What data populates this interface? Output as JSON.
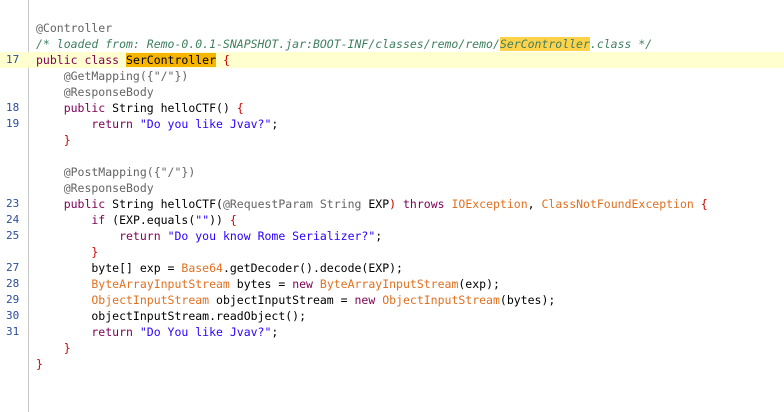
{
  "editor": {
    "lines": [
      {
        "num": "",
        "highlight": false,
        "tokens": [
          {
            "t": "@Controller",
            "c": "ann"
          }
        ]
      },
      {
        "num": "",
        "highlight": false,
        "tokens": [
          {
            "t": "/* loaded from: Remo-0.0.1-SNAPSHOT.jar:BOOT-INF/classes/remo/remo/",
            "c": "cmt"
          },
          {
            "t": "SerController",
            "c": "cmt occ"
          },
          {
            "t": ".class */",
            "c": "cmt"
          }
        ]
      },
      {
        "num": "17",
        "highlight": true,
        "tokens": [
          {
            "t": "public class ",
            "c": "kw"
          },
          {
            "t": "SerController",
            "c": "default match"
          },
          {
            "t": " {",
            "c": "punct"
          }
        ]
      },
      {
        "num": "",
        "highlight": false,
        "tokens": [
          {
            "t": "    @GetMapping({\"/\"})",
            "c": "ann"
          }
        ]
      },
      {
        "num": "",
        "highlight": false,
        "tokens": [
          {
            "t": "    @ResponseBody",
            "c": "ann"
          }
        ]
      },
      {
        "num": "18",
        "highlight": false,
        "tokens": [
          {
            "t": "    public ",
            "c": "kw"
          },
          {
            "t": "String helloCTF() ",
            "c": "default"
          },
          {
            "t": "{",
            "c": "punct"
          }
        ]
      },
      {
        "num": "19",
        "highlight": false,
        "tokens": [
          {
            "t": "        return ",
            "c": "kw"
          },
          {
            "t": "\"Do you like Jvav?\"",
            "c": "str"
          },
          {
            "t": ";",
            "c": "default"
          }
        ]
      },
      {
        "num": "",
        "highlight": false,
        "tokens": [
          {
            "t": "    }",
            "c": "punct"
          }
        ]
      },
      {
        "num": "",
        "highlight": false,
        "tokens": []
      },
      {
        "num": "",
        "highlight": false,
        "tokens": [
          {
            "t": "    @PostMapping({\"/\"})",
            "c": "ann"
          }
        ]
      },
      {
        "num": "",
        "highlight": false,
        "tokens": [
          {
            "t": "    @ResponseBody",
            "c": "ann"
          }
        ]
      },
      {
        "num": "23",
        "highlight": false,
        "tokens": [
          {
            "t": "    public ",
            "c": "kw"
          },
          {
            "t": "String helloCTF(",
            "c": "default"
          },
          {
            "t": "@RequestParam String ",
            "c": "ann"
          },
          {
            "t": "EXP",
            "c": "default"
          },
          {
            "t": ") ",
            "c": "punct"
          },
          {
            "t": "throws ",
            "c": "kw"
          },
          {
            "t": "IOException",
            "c": "type"
          },
          {
            "t": ", ",
            "c": "default"
          },
          {
            "t": "ClassNotFoundException ",
            "c": "type"
          },
          {
            "t": "{",
            "c": "punct"
          }
        ]
      },
      {
        "num": "24",
        "highlight": false,
        "tokens": [
          {
            "t": "        if ",
            "c": "kw"
          },
          {
            "t": "(EXP.equals(",
            "c": "default"
          },
          {
            "t": "\"\"",
            "c": "str"
          },
          {
            "t": ")) ",
            "c": "default"
          },
          {
            "t": "{",
            "c": "punct"
          }
        ]
      },
      {
        "num": "25",
        "highlight": false,
        "tokens": [
          {
            "t": "            return ",
            "c": "kw"
          },
          {
            "t": "\"Do you know Rome Serializer?\"",
            "c": "str"
          },
          {
            "t": ";",
            "c": "default"
          }
        ]
      },
      {
        "num": "",
        "highlight": false,
        "tokens": [
          {
            "t": "        }",
            "c": "punct"
          }
        ]
      },
      {
        "num": "27",
        "highlight": false,
        "tokens": [
          {
            "t": "        byte[] exp = ",
            "c": "default"
          },
          {
            "t": "Base64",
            "c": "type"
          },
          {
            "t": ".getDecoder().decode(EXP);",
            "c": "default"
          }
        ]
      },
      {
        "num": "28",
        "highlight": false,
        "tokens": [
          {
            "t": "        ByteArrayInputStream ",
            "c": "type"
          },
          {
            "t": "bytes = ",
            "c": "default"
          },
          {
            "t": "new ",
            "c": "kw"
          },
          {
            "t": "ByteArrayInputStream",
            "c": "type"
          },
          {
            "t": "(exp);",
            "c": "default"
          }
        ]
      },
      {
        "num": "29",
        "highlight": false,
        "tokens": [
          {
            "t": "        ObjectInputStream ",
            "c": "type"
          },
          {
            "t": "objectInputStream = ",
            "c": "default"
          },
          {
            "t": "new ",
            "c": "kw"
          },
          {
            "t": "ObjectInputStream",
            "c": "type"
          },
          {
            "t": "(bytes);",
            "c": "default"
          }
        ]
      },
      {
        "num": "30",
        "highlight": false,
        "tokens": [
          {
            "t": "        objectInputStream.readObject();",
            "c": "default"
          }
        ]
      },
      {
        "num": "31",
        "highlight": false,
        "tokens": [
          {
            "t": "        return ",
            "c": "kw"
          },
          {
            "t": "\"Do You like Jvav?\"",
            "c": "str"
          },
          {
            "t": ";",
            "c": "default"
          }
        ]
      },
      {
        "num": "",
        "highlight": false,
        "tokens": [
          {
            "t": "    }",
            "c": "punct"
          }
        ]
      },
      {
        "num": "",
        "highlight": false,
        "tokens": [
          {
            "t": "}",
            "c": "punct"
          }
        ]
      }
    ],
    "colors": {
      "keyword": "#7f0055",
      "string": "#2a00ff",
      "annotation": "#646464",
      "comment": "#3f7f5f",
      "type": "#e07020",
      "brace": "#d00000",
      "current_line": "#ffffd0",
      "match_highlight": "#f7b500"
    }
  }
}
